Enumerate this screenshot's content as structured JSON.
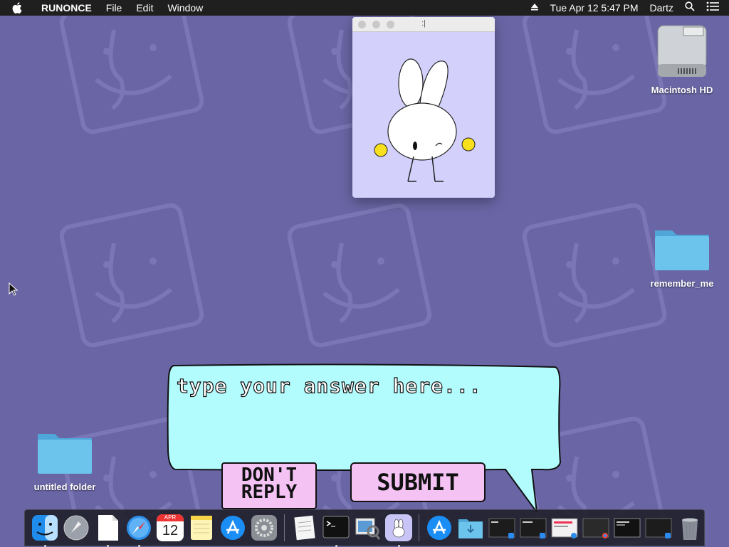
{
  "menubar": {
    "apple_icon": "apple-icon",
    "app_name": "RUNONCE",
    "menus": [
      "File",
      "Edit",
      "Window"
    ],
    "datetime": "Tue Apr 12  5:47 PM",
    "user": "Dartz"
  },
  "desktop": {
    "icons": [
      {
        "label": "Macintosh HD",
        "icon": "hard-drive-icon"
      },
      {
        "label": "remember_me",
        "icon": "folder-icon"
      },
      {
        "label": "untitled folder",
        "icon": "folder-icon"
      }
    ]
  },
  "window": {
    "title": ":|",
    "image": "bunny-character"
  },
  "dialog": {
    "answer_placeholder": "type your answer here...",
    "dont_reply_label": "DON'T REPLY",
    "submit_label": "SUBMIT",
    "bubble_color": "#b2fcfe",
    "button_color": "#f4c2f3"
  },
  "dock": {
    "calendar_month": "APR",
    "calendar_day": "12",
    "items": [
      "finder-icon",
      "launchpad-icon",
      "document-icon",
      "safari-icon",
      "calendar-icon",
      "notes-icon",
      "app-store-icon",
      "system-preferences-icon",
      "textedit-icon",
      "terminal-icon",
      "preview-icon",
      "runonce-bunny-icon",
      "app-store-downloads-icon",
      "downloads-folder-icon",
      "window-thumbnail-icon",
      "window-thumbnail-icon",
      "window-thumbnail-icon",
      "window-thumbnail-icon",
      "window-thumbnail-icon",
      "window-thumbnail-icon",
      "trash-icon"
    ]
  }
}
